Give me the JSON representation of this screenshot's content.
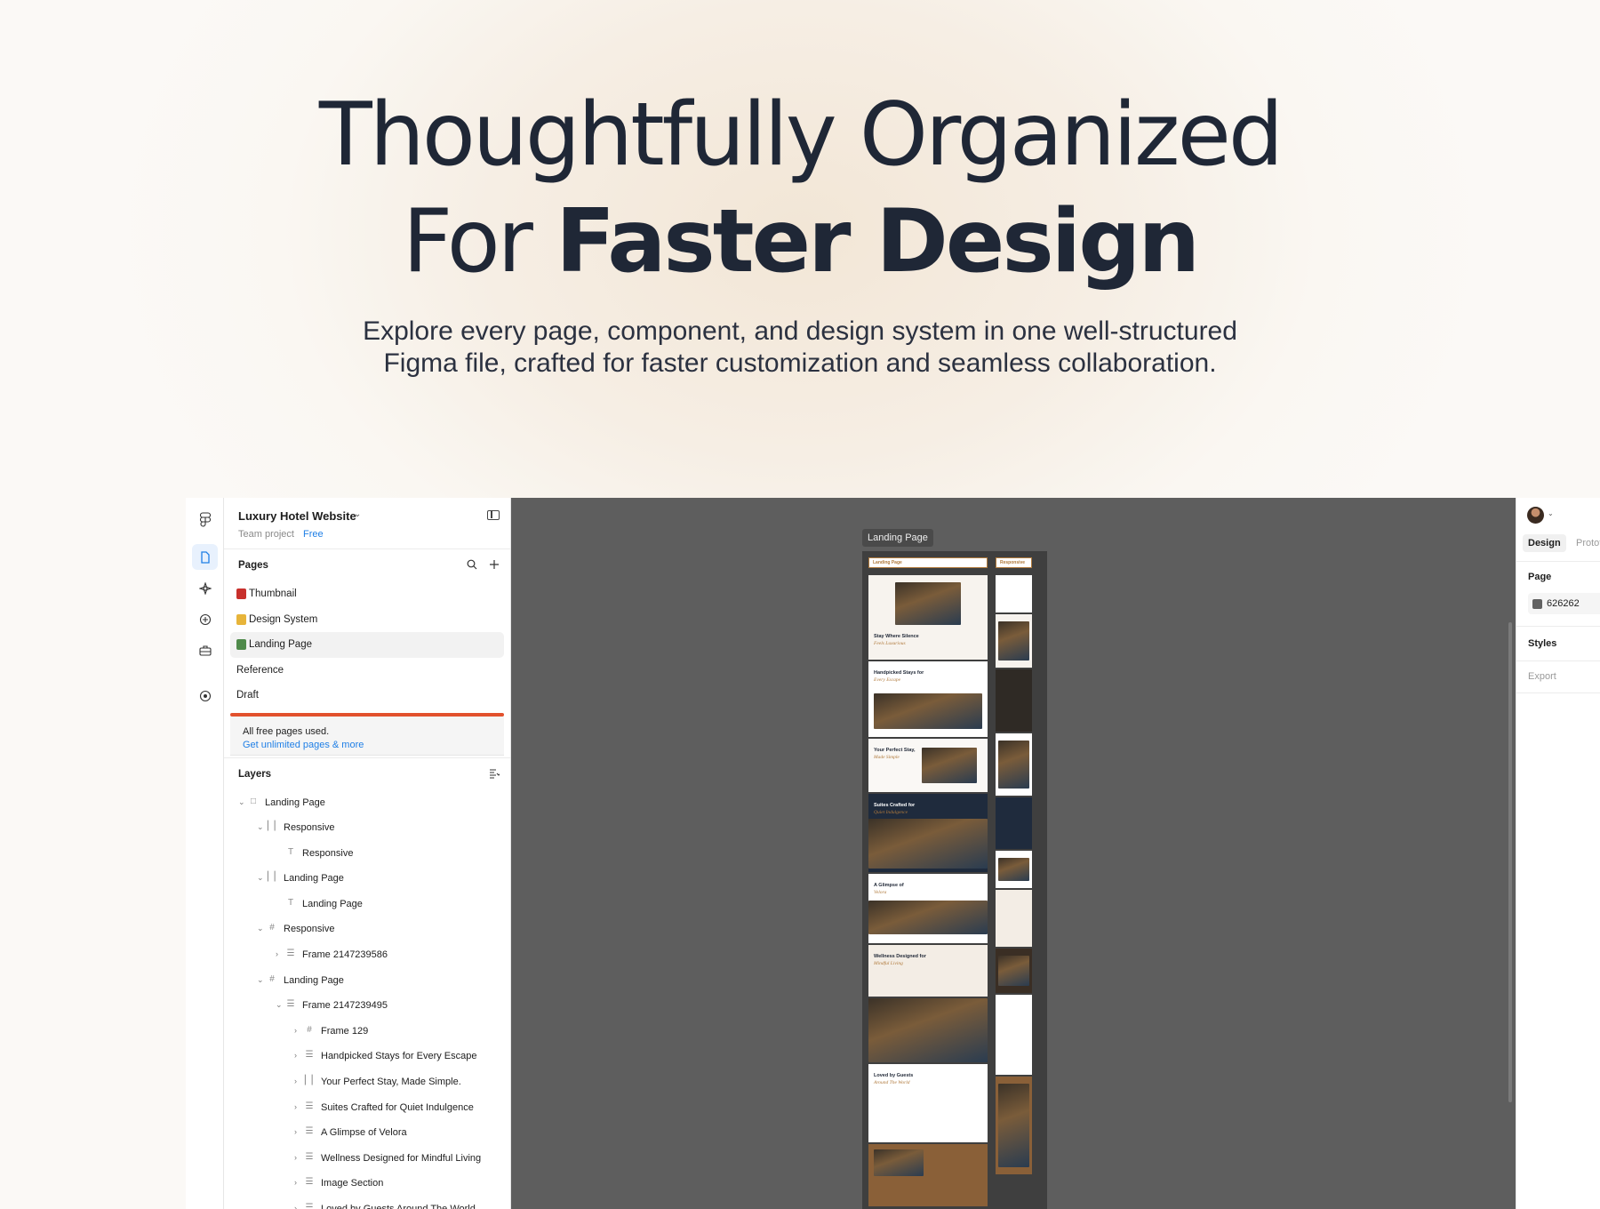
{
  "hero": {
    "title_line1": "Thoughtfully Organized",
    "title_line2_regular": "For ",
    "title_line2_bold": "Faster Design",
    "subtitle_line1": "Explore every page, component, and design system in one well-structured",
    "subtitle_line2": "Figma file, crafted for faster customization and seamless collaboration."
  },
  "file": {
    "name": "Luxury Hotel Website",
    "team": "Team project",
    "plan": "Free"
  },
  "pages": {
    "title": "Pages",
    "items": [
      {
        "label": "Thumbnail",
        "icon": "red-book-icon",
        "color": "#c8302c"
      },
      {
        "label": "Design System",
        "icon": "palette-icon",
        "color": "#e7b43a"
      },
      {
        "label": "Landing Page",
        "icon": "picture-icon",
        "color": "#4f8a4a"
      },
      {
        "label": "Reference",
        "icon": "",
        "color": ""
      },
      {
        "label": "Draft",
        "icon": "",
        "color": ""
      }
    ],
    "selected": "Landing Page"
  },
  "limit": {
    "text": "All free pages used.",
    "link": "Get unlimited pages & more"
  },
  "layers": {
    "title": "Layers",
    "items": [
      {
        "label": "Landing Page",
        "depth": 0,
        "icon": "page",
        "caret": "open"
      },
      {
        "label": "Responsive",
        "depth": 1,
        "icon": "autolayout",
        "caret": "open"
      },
      {
        "label": "Responsive",
        "depth": 2,
        "icon": "text",
        "caret": ""
      },
      {
        "label": "Landing Page",
        "depth": 1,
        "icon": "autolayout",
        "caret": "open"
      },
      {
        "label": "Landing Page",
        "depth": 2,
        "icon": "text",
        "caret": ""
      },
      {
        "label": "Responsive",
        "depth": 1,
        "icon": "frame",
        "caret": "open"
      },
      {
        "label": "Frame 2147239586",
        "depth": 2,
        "icon": "stack",
        "caret": "closed"
      },
      {
        "label": "Landing Page",
        "depth": 1,
        "icon": "frame",
        "caret": "open"
      },
      {
        "label": "Frame 2147239495",
        "depth": 2,
        "icon": "stack",
        "caret": "open"
      },
      {
        "label": "Frame 129",
        "depth": 3,
        "icon": "frame",
        "caret": "closed"
      },
      {
        "label": "Handpicked Stays for Every Escape",
        "depth": 3,
        "icon": "stack",
        "caret": "closed"
      },
      {
        "label": "Your Perfect Stay, Made Simple.",
        "depth": 3,
        "icon": "autolayout",
        "caret": "closed"
      },
      {
        "label": "Suites Crafted for Quiet Indulgence",
        "depth": 3,
        "icon": "stack",
        "caret": "closed"
      },
      {
        "label": "A Glimpse of Velora",
        "depth": 3,
        "icon": "stack",
        "caret": "closed"
      },
      {
        "label": "Wellness Designed for Mindful Living",
        "depth": 3,
        "icon": "stack",
        "caret": "closed"
      },
      {
        "label": "Image Section",
        "depth": 3,
        "icon": "stack",
        "caret": "closed"
      },
      {
        "label": "Loved by Guests Around The World",
        "depth": 3,
        "icon": "stack",
        "caret": "closed"
      }
    ]
  },
  "canvas": {
    "frame_tag": "Landing Page",
    "col_a_label": "Landing Page",
    "col_b_label": "Responsive",
    "bg": "#5e5e5e",
    "sections": [
      {
        "title": "Stay Where Silence",
        "italic": "Feels Luxurious"
      },
      {
        "title": "Handpicked Stays for",
        "italic": "Every Escape"
      },
      {
        "title": "Your Perfect Stay,",
        "italic": "Made Simple"
      },
      {
        "title": "Suites Crafted for",
        "italic": "Quiet Indulgence"
      },
      {
        "title": "A Glimpse of",
        "italic": "Velora"
      },
      {
        "title": "Wellness Designed for",
        "italic": "Mindful Living"
      },
      {
        "title": "",
        "italic": ""
      },
      {
        "title": "Loved by Guests",
        "italic": "Around The World"
      }
    ]
  },
  "right_panel": {
    "tabs": [
      "Design",
      "Prototype"
    ],
    "active_tab": "Design",
    "page_label": "Page",
    "page_color": "626262",
    "styles_label": "Styles",
    "export_label": "Export"
  },
  "colors": {
    "accent": "#1f7fe6",
    "warning": "#e2512d",
    "brand_brown": "#b07a3c"
  }
}
